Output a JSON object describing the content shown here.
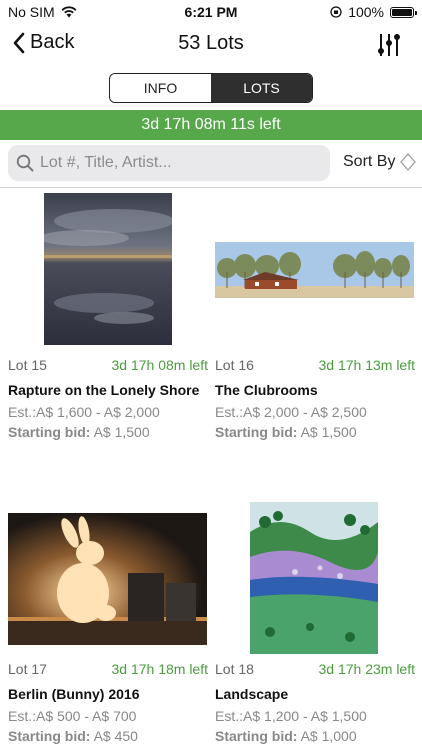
{
  "status": {
    "carrier": "No SIM",
    "time": "6:21 PM",
    "battery": "100%"
  },
  "nav": {
    "back_label": "Back",
    "title": "53 Lots"
  },
  "segments": {
    "info": "INFO",
    "lots": "LOTS",
    "selected": "LOTS"
  },
  "timer": "3d 17h 08m 11s left",
  "search": {
    "placeholder": "Lot #, Title, Artist..."
  },
  "sort_label": "Sort By",
  "lots": [
    {
      "lot": "Lot 15",
      "time_left": "3d 17h 08m left",
      "title": "Rapture on the Lonely Shore",
      "est_label": "Est.:",
      "estimate": "A$ 1,600 - A$ 2,000",
      "bid_label": "Starting bid:",
      "starting_bid": "A$ 1,500"
    },
    {
      "lot": "Lot 16",
      "time_left": "3d 17h 13m left",
      "title": "The Clubrooms",
      "est_label": "Est.:",
      "estimate": "A$ 2,000 - A$ 2,500",
      "bid_label": "Starting bid:",
      "starting_bid": "A$ 1,500"
    },
    {
      "lot": "Lot 17",
      "time_left": "3d 17h 18m left",
      "title": "Berlin (Bunny) 2016",
      "est_label": "Est.:",
      "estimate": "A$ 500 - A$ 700",
      "bid_label": "Starting bid:",
      "starting_bid": "A$ 450"
    },
    {
      "lot": "Lot 18",
      "time_left": "3d 17h 23m left",
      "title": "Landscape",
      "est_label": "Est.:",
      "estimate": "A$ 1,200 - A$ 1,500",
      "bid_label": "Starting bid:",
      "starting_bid": "A$ 1,000"
    }
  ],
  "colors": {
    "accent_green": "#56a84a",
    "time_green": "#4a9e3f",
    "segment_selected": "#2f2f2f"
  }
}
